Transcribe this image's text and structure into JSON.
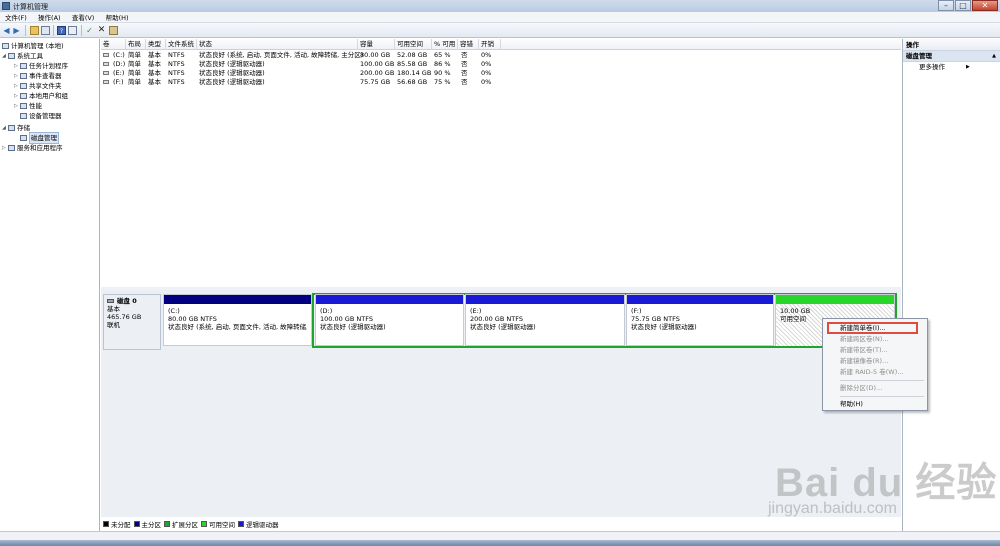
{
  "window": {
    "title": "计算机管理"
  },
  "menu": [
    "文件(F)",
    "操作(A)",
    "查看(V)",
    "帮助(H)"
  ],
  "tree": [
    {
      "label": "计算机管理 (本地)",
      "level": 0,
      "expander": ""
    },
    {
      "label": "系统工具",
      "level": 1,
      "expander": "◢"
    },
    {
      "label": "任务计划程序",
      "level": 2,
      "expander": "▷"
    },
    {
      "label": "事件查看器",
      "level": 2,
      "expander": "▷"
    },
    {
      "label": "共享文件夹",
      "level": 2,
      "expander": "▷"
    },
    {
      "label": "本地用户和组",
      "level": 2,
      "expander": "▷"
    },
    {
      "label": "性能",
      "level": 2,
      "expander": "▷"
    },
    {
      "label": "设备管理器",
      "level": 2,
      "expander": ""
    },
    {
      "label": "存储",
      "level": 1,
      "expander": "◢"
    },
    {
      "label": "磁盘管理",
      "level": 2,
      "expander": ""
    },
    {
      "label": "服务和应用程序",
      "level": 1,
      "expander": "▷"
    }
  ],
  "columns": [
    "卷",
    "布局",
    "类型",
    "文件系统",
    "状态",
    "容量",
    "可用空间",
    "% 可用",
    "容错",
    "开销"
  ],
  "volumes": [
    [
      "(C:)",
      "简单",
      "基本",
      "NTFS",
      "状态良好 (系统, 启动, 页面文件, 活动, 故障转储, 主分区)",
      "80.00 GB",
      "52.08 GB",
      "65 %",
      "否",
      "0%"
    ],
    [
      "(D:)",
      "简单",
      "基本",
      "NTFS",
      "状态良好 (逻辑驱动器)",
      "100.00 GB",
      "85.58 GB",
      "86 %",
      "否",
      "0%"
    ],
    [
      "(E:)",
      "简单",
      "基本",
      "NTFS",
      "状态良好 (逻辑驱动器)",
      "200.00 GB",
      "180.14 GB",
      "90 %",
      "否",
      "0%"
    ],
    [
      "(F:)",
      "简单",
      "基本",
      "NTFS",
      "状态良好 (逻辑驱动器)",
      "75.75 GB",
      "56.68 GB",
      "75 %",
      "否",
      "0%"
    ]
  ],
  "disk": {
    "name": "磁盘 0",
    "type": "基本",
    "size": "465.76 GB",
    "status": "联机"
  },
  "partitions": [
    {
      "name": "(C:)",
      "size": "80.00 GB NTFS",
      "status": "状态良好 (系统, 启动, 页面文件, 活动, 故障转储, 主"
    },
    {
      "name": "(D:)",
      "size": "100.00 GB NTFS",
      "status": "状态良好 (逻辑驱动器)"
    },
    {
      "name": "(E:)",
      "size": "200.00 GB NTFS",
      "status": "状态良好 (逻辑驱动器)"
    },
    {
      "name": "(F:)",
      "size": "75.75 GB NTFS",
      "status": "状态良好 (逻辑驱动器)"
    },
    {
      "name": "",
      "size": "10.00 GB",
      "status": "可用空间"
    }
  ],
  "legend": [
    {
      "label": "未分配",
      "color": "#000000"
    },
    {
      "label": "主分区",
      "color": "#000080"
    },
    {
      "label": "扩展分区",
      "color": "#1fa52c"
    },
    {
      "label": "可用空间",
      "color": "#27d629"
    },
    {
      "label": "逻辑驱动器",
      "color": "#1a1ad6"
    }
  ],
  "actions": {
    "header": "操作",
    "section": "磁盘管理",
    "more": "更多操作"
  },
  "context_menu": [
    {
      "label": "新建简单卷(I)...",
      "disabled": false
    },
    {
      "label": "新建跨区卷(N)...",
      "disabled": true
    },
    {
      "label": "新建带区卷(T)...",
      "disabled": true
    },
    {
      "label": "新建镜像卷(R)...",
      "disabled": true
    },
    {
      "label": "新建 RAID-5 卷(W)...",
      "disabled": true
    },
    {
      "label": "删除分区(D)...",
      "disabled": true
    },
    {
      "label": "帮助(H)",
      "disabled": false
    }
  ],
  "watermark": {
    "main": "Bai du 经验",
    "sub": "jingyan.baidu.com"
  },
  "icons": [
    "back-arrow-icon",
    "forward-arrow-icon",
    "folder-up-icon",
    "show-pane-icon",
    "help-icon",
    "list-icon",
    "check-icon",
    "delete-icon",
    "properties-icon"
  ]
}
